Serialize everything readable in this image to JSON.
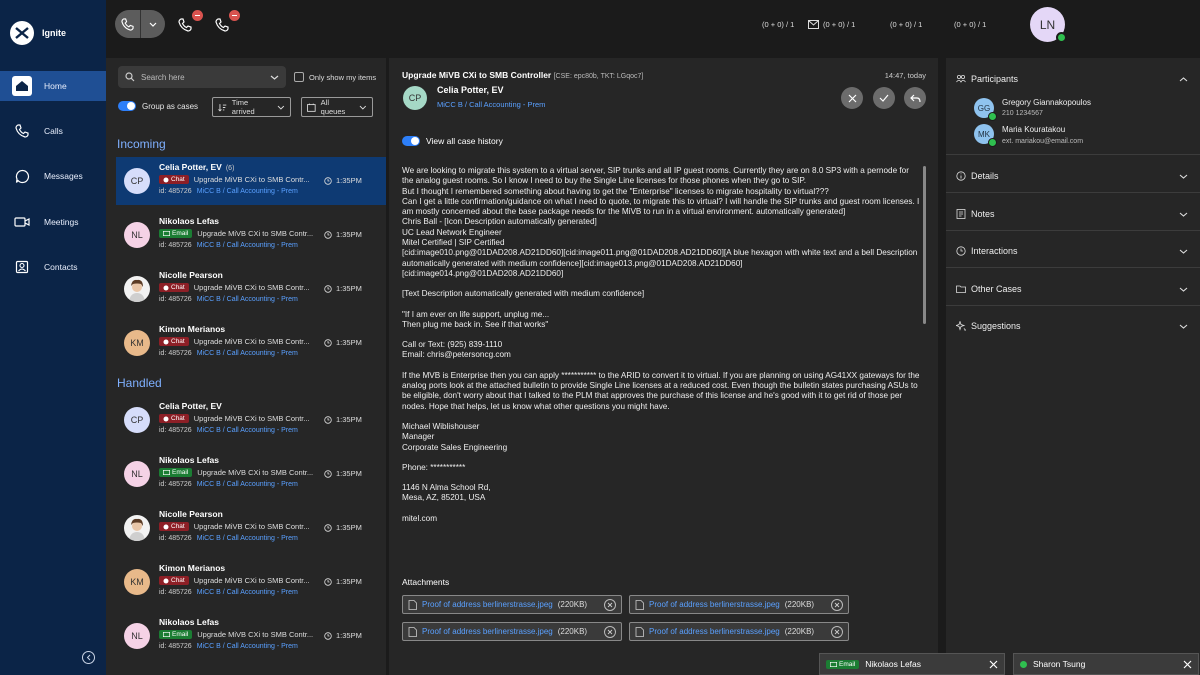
{
  "app": {
    "name": "Ignite"
  },
  "nav": [
    {
      "label": "Home",
      "icon": "home-icon"
    },
    {
      "label": "Calls",
      "icon": "phone-icon"
    },
    {
      "label": "Messages",
      "icon": "message-icon"
    },
    {
      "label": "Meetings",
      "icon": "video-icon"
    },
    {
      "label": "Contacts",
      "icon": "contact-icon"
    }
  ],
  "topbar": {
    "counters": [
      "(0 + 0) / 1",
      "(0 + 0) / 1",
      "(0 + 0) / 1",
      "(0 + 0) / 1"
    ],
    "user_initials": "LN"
  },
  "list": {
    "search_placeholder": "Search here",
    "only_mine": "Only show my items",
    "group_as_cases": "Group as cases",
    "sort": "Time arrived",
    "queues": "All queues",
    "incoming_label": "Incoming",
    "handled_label": "Handled",
    "incoming": [
      {
        "initials": "CP",
        "name": "Celia Potter, EV",
        "count": "(6)",
        "channel": "Chat",
        "subject": "Upgrade MiVB CXi to SMB Contr...",
        "time": "1:35PM",
        "id": "id: 485726",
        "queue": "MiCC B / Call Accounting - Prem"
      },
      {
        "initials": "NL",
        "name": "Nikolaos Lefas",
        "count": "",
        "channel": "Email",
        "subject": "Upgrade MiVB CXi to SMB Contr...",
        "time": "1:35PM",
        "id": "id: 485726",
        "queue": "MiCC B / Call Accounting - Prem"
      },
      {
        "initials": "",
        "name": "Nicolle Pearson",
        "count": "",
        "channel": "Chat",
        "subject": "Upgrade MiVB CXi to SMB Contr...",
        "time": "1:35PM",
        "id": "id: 485726",
        "queue": "MiCC B / Call Accounting - Prem"
      },
      {
        "initials": "KM",
        "name": "Kimon Merianos",
        "count": "",
        "channel": "Chat",
        "subject": "Upgrade MiVB CXi to SMB Contr...",
        "time": "1:35PM",
        "id": "id: 485726",
        "queue": "MiCC B / Call Accounting - Prem"
      }
    ],
    "handled": [
      {
        "initials": "CP",
        "name": "Celia Potter, EV",
        "channel": "Chat",
        "subject": "Upgrade MiVB CXi to SMB Contr...",
        "time": "1:35PM",
        "id": "id: 485726",
        "queue": "MiCC B / Call Accounting - Prem"
      },
      {
        "initials": "NL",
        "name": "Nikolaos Lefas",
        "channel": "Email",
        "subject": "Upgrade MiVB CXi to SMB Contr...",
        "time": "1:35PM",
        "id": "id: 485726",
        "queue": "MiCC B / Call Accounting - Prem"
      },
      {
        "initials": "",
        "name": "Nicolle Pearson",
        "channel": "Chat",
        "subject": "Upgrade MiVB CXi to SMB Contr...",
        "time": "1:35PM",
        "id": "id: 485726",
        "queue": "MiCC B / Call Accounting - Prem"
      },
      {
        "initials": "KM",
        "name": "Kimon Merianos",
        "channel": "Chat",
        "subject": "Upgrade MiVB CXi to SMB Contr...",
        "time": "1:35PM",
        "id": "id: 485726",
        "queue": "MiCC B / Call Accounting - Prem"
      },
      {
        "initials": "NL",
        "name": "Nikolaos Lefas",
        "channel": "Email",
        "subject": "Upgrade MiVB CXi to SMB Contr...",
        "time": "1:35PM",
        "id": "id: 485726",
        "queue": "MiCC B / Call Accounting - Prem"
      }
    ]
  },
  "case": {
    "subject": "Upgrade MiVB CXi to SMB Controller",
    "subject_meta": "[CSE: epc80b, TKT: LGqoc7]",
    "time": "14:47, today",
    "initials": "CP",
    "contact": "Celia Potter, EV",
    "queue": "MiCC B / Call Accounting - Prem",
    "history_label": "View all case history",
    "paragraphs": [
      "We are looking to migrate this system to a virtual server, SIP trunks and all IP guest rooms. Currently they are on 8.0 SP3 with a pernode for the analog guest rooms. So I know I need to buy the Single Line licenses for those phones when they go to SIP.\nBut I thought I remembered something about having to get the \"Enterprise\" licenses to migrate hospitality to virtual???\nCan I get a little confirmation/guidance on what I need to quote, to migrate this to virtual? I will handle the SIP trunks and guest room licenses. I am mostly concerned about the base package needs for the MiVB to run in a virtual environment.  automatically generated]\nChris Ball - [Icon Description automatically generated]\nUC Lead Network Engineer\nMitel Certified | SIP Certified\n[cid:image010.png@01DAD208.AD21DD60][cid:image011.png@01DAD208.AD21DD60][A blue hexagon with white text and a bell Description automatically generated with medium confidence][cid:image013.png@01DAD208.AD21DD60]\n[cid:image014.png@01DAD208.AD21DD60]",
      "[Text Description automatically generated with medium confidence]",
      "\"If I am ever on life support, unplug me...\nThen plug me back in. See if that works\"",
      "Call or Text: (925) 839-1110\nEmail: chris@petersoncg.com",
      "",
      "If the MVB is Enterprise then you can apply *********** to the ARID to convert it to virtual.  If you are planning on using AG41XX gateways for the analog ports look at the attached bulletin to provide Single Line licenses at a reduced cost.  Even though the bulletin states purchasing ASUs to be eligible, don't worry about that I talked to the PLM that approves the purchase of this license and he's good with it to get rid of those per nodes.  Hope that helps, let us know what other questions you might have.",
      "",
      "",
      "Michael Wiblishouser\nManager\nCorporate Sales Engineering",
      "Phone: ***********",
      "1146 N Alma School Rd,\nMesa, AZ, 85201, USA",
      "mitel.com"
    ],
    "attachments_label": "Attachments",
    "attachments": [
      {
        "name": "Proof of address berlinerstrasse.jpeg",
        "size": "(220KB)"
      },
      {
        "name": "Proof of address berlinerstrasse.jpeg",
        "size": "(220KB)"
      },
      {
        "name": "Proof of address berlinerstrasse.jpeg",
        "size": "(220KB)"
      },
      {
        "name": "Proof of address berlinerstrasse.jpeg",
        "size": "(220KB)"
      }
    ]
  },
  "right": {
    "participants_label": "Participants",
    "participants": [
      {
        "initials": "GG",
        "name": "Gregory Giannakopoulos",
        "sub": "210 1234567"
      },
      {
        "initials": "MK",
        "name": "Maria Kouratakou",
        "sub": "ext. mariakou@email.com"
      }
    ],
    "sections": [
      "Details",
      "Notes",
      "Interactions",
      "Other Cases",
      "Suggestions"
    ]
  },
  "bottom": {
    "email_chip": {
      "channel": "Email",
      "name": "Nikolaos Lefas"
    },
    "user_chip": {
      "name": "Sharon Tsung"
    }
  },
  "colors": {
    "nav_bg": "#0b2447",
    "active": "#1f4f94",
    "accent": "#2d7ff9",
    "chat": "#8d1f26",
    "email": "#1b7d33",
    "online": "#2fbf4f"
  }
}
